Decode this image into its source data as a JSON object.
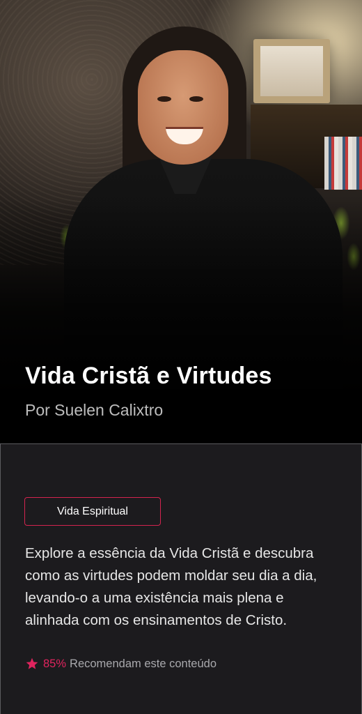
{
  "course": {
    "title": "Vida Cristã e Virtudes",
    "author": "Por Suelen Calixtro",
    "category_tag": "Vida Espiritual",
    "description": "Explore a essência da Vida Cristã e descubra como as virtudes podem moldar seu dia a dia, levando-o a uma existência mais plena e alinhada com os ensinamentos de Cristo.",
    "rating": {
      "icon": "star-icon",
      "percent": "85%",
      "label": "Recomendam este conteúdo"
    }
  },
  "colors": {
    "accent": "#e0245e",
    "background": "#1c1b1e",
    "hero_text": "#ffffff"
  }
}
